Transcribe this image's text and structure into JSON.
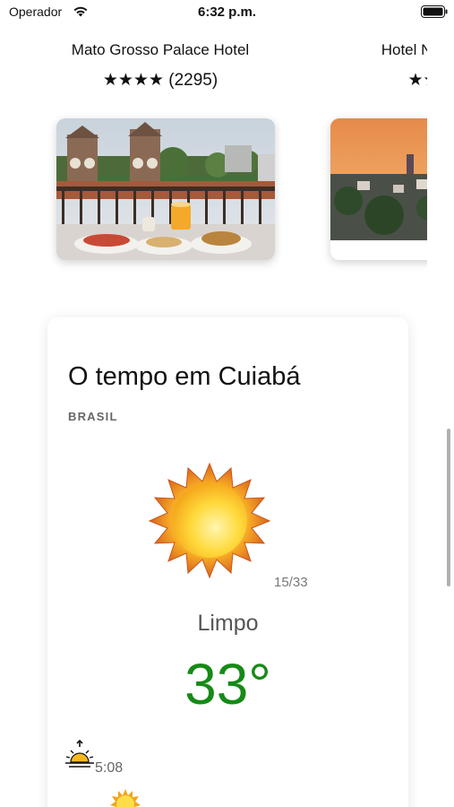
{
  "status_bar": {
    "carrier": "Operador",
    "time": "6:32 p.m."
  },
  "hotels": [
    {
      "name": "Mato Grosso Palace Hotel",
      "stars": "★★★★",
      "reviews": "(2295)",
      "rating_value": 4
    },
    {
      "name": "Hotel Nacional",
      "stars": "★★★",
      "reviews": "",
      "rating_value": 3
    }
  ],
  "weather": {
    "title": "O tempo em Cuiabá",
    "country": "BRASIL",
    "icon": "sun-icon",
    "temp_range": "15/33",
    "condition": "Limpo",
    "temperature": "33°",
    "temperature_color": "#168a16",
    "sunrise_icon": "sunrise-icon",
    "sunrise_time": "5:08"
  }
}
